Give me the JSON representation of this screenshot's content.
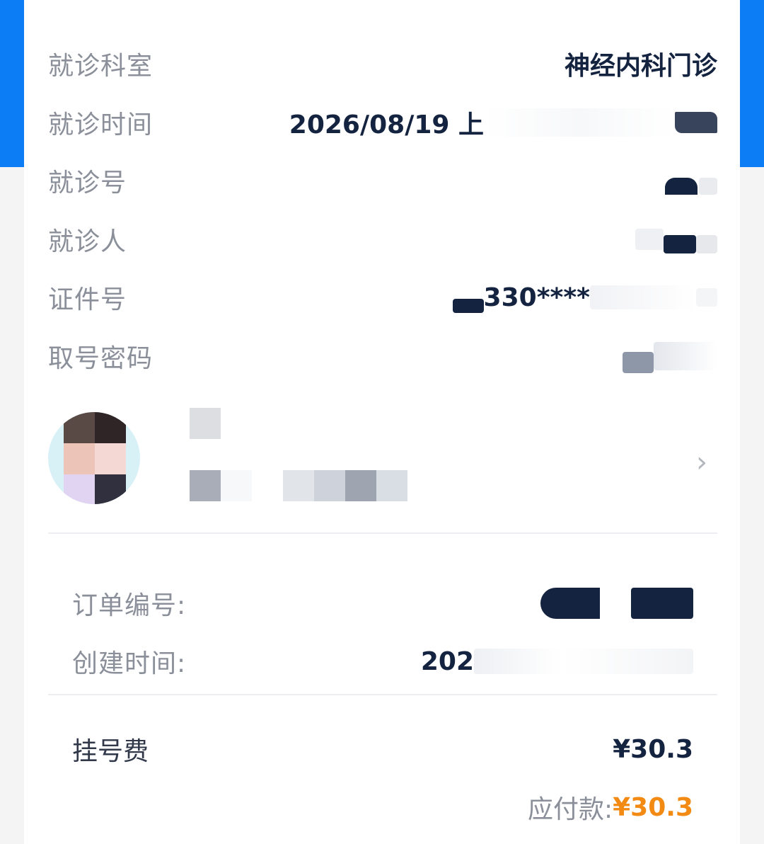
{
  "visit_info": {
    "department": {
      "label": "就诊科室",
      "value": "神经内科门诊"
    },
    "visit_time": {
      "label": "就诊时间",
      "value": "2026/08/19 上"
    },
    "visit_number": {
      "label": "就诊号",
      "value": ""
    },
    "patient": {
      "label": "就诊人",
      "value": ""
    },
    "id_number": {
      "label": "证件号",
      "value": "330****"
    },
    "pickup_code": {
      "label": "取号密码",
      "value": ""
    }
  },
  "doctor": {
    "name": "",
    "title": ""
  },
  "order": {
    "order_no": {
      "label": "订单编号:",
      "value": ""
    },
    "created": {
      "label": "创建时间:",
      "value": "202"
    }
  },
  "fees": {
    "registration": {
      "label": "挂号费",
      "value": "¥30.3"
    },
    "payable": {
      "label": "应付款:",
      "value": "¥30.3"
    }
  },
  "colors": {
    "brand_blue": "#0d7df5",
    "amount_orange": "#f28a13",
    "label_gray": "#8a8f99",
    "value_navy": "#14233f"
  },
  "icons": {
    "chevron": "chevron-right-icon"
  }
}
